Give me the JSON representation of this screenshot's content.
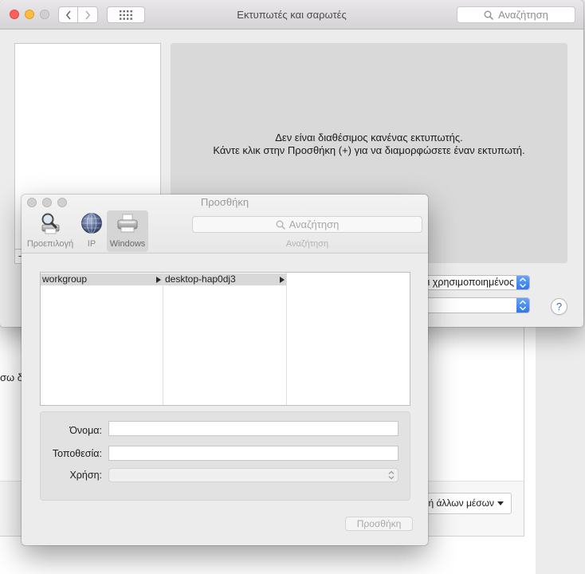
{
  "window": {
    "title": "Εκτυπωτές και σαρωτές",
    "search_placeholder": "Αναζήτηση",
    "empty_message_line1": "Δεν είναι διαθέσιμος κανένας εκτυπωτής.",
    "empty_message_line2": "Κάντε κλικ στην Προσθήκη (+) για να διαμορφώσετε έναν εκτυπωτή.",
    "default_printer_value": "ι χρησιμοποιημένος",
    "default_paper_value": "",
    "remove_label": "-",
    "help_label": "?"
  },
  "background_page": {
    "partial_text": "σω δι",
    "footer_button_label": "ή άλλων μέσων"
  },
  "add_sheet": {
    "title": "Προσθήκη",
    "toolbar": [
      {
        "label": "Προεπιλογή",
        "icon": "default-printer-icon",
        "selected": false
      },
      {
        "label": "IP",
        "icon": "globe-icon",
        "selected": false
      },
      {
        "label": "Windows",
        "icon": "windows-printer-icon",
        "selected": true
      }
    ],
    "search_placeholder": "Αναζήτηση",
    "search_label": "Αναζήτηση",
    "browser": {
      "columns": [
        [
          {
            "label": "workgroup",
            "has_children": true,
            "selected": true
          }
        ],
        [
          {
            "label": "desktop-hap0dj3",
            "has_children": true,
            "selected": true
          }
        ],
        []
      ]
    },
    "fields": {
      "name_label": "Όνομα:",
      "name_value": "",
      "location_label": "Τοποθεσία:",
      "location_value": "",
      "use_label": "Χρήση:",
      "use_value": ""
    },
    "add_button_label": "Προσθήκη",
    "add_button_enabled": false
  },
  "colors": {
    "close": "#fc605c",
    "minimize": "#fdbc40",
    "inactive_light": "#d0d0d0",
    "accent_blue": "#3f87f5",
    "selection_gray": "#d8d8d8"
  }
}
